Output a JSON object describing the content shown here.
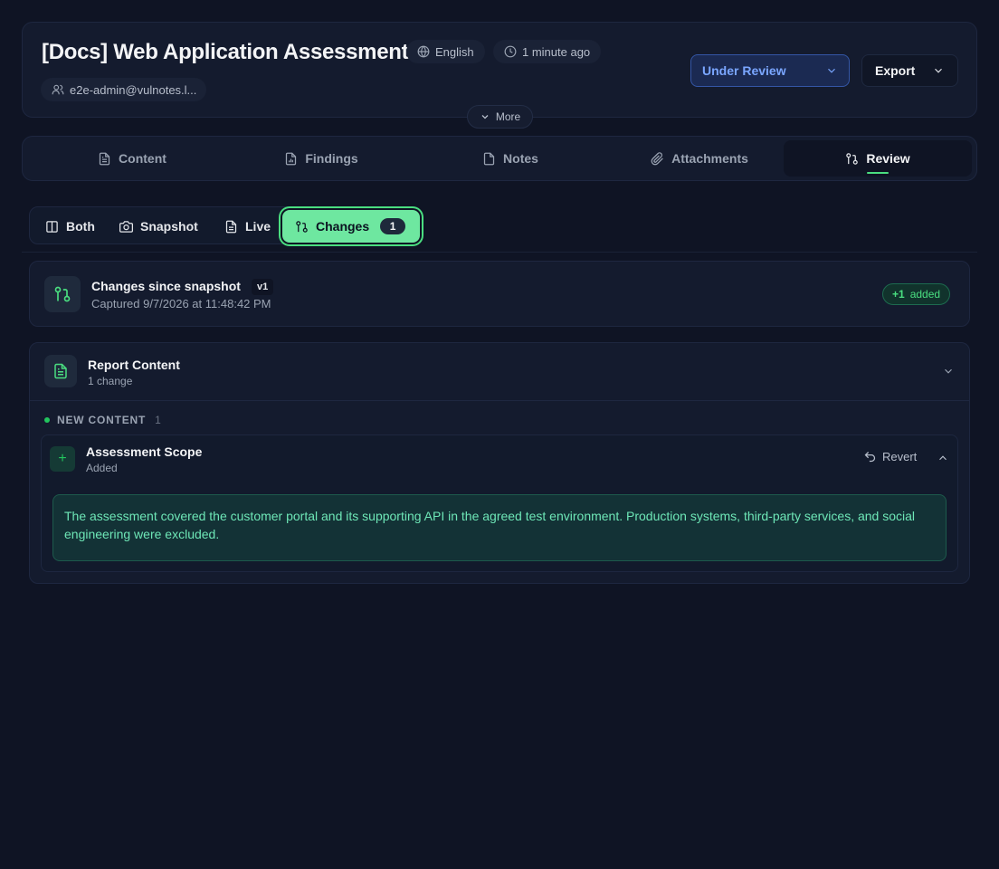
{
  "header": {
    "title": "[Docs] Web Application Assessment",
    "language": "English",
    "updated": "1 minute ago",
    "user": "e2e-admin@vulnotes.l...",
    "status": "Under Review",
    "export_label": "Export",
    "more_label": "More"
  },
  "tabs": [
    {
      "label": "Content",
      "icon": "document-icon"
    },
    {
      "label": "Findings",
      "icon": "chart-file-icon"
    },
    {
      "label": "Notes",
      "icon": "file-icon"
    },
    {
      "label": "Attachments",
      "icon": "paperclip-icon"
    },
    {
      "label": "Review",
      "icon": "git-compare-icon",
      "active": true
    }
  ],
  "view_modes": {
    "both": "Both",
    "snapshot": "Snapshot",
    "live": "Live",
    "changes": "Changes",
    "changes_count": "1"
  },
  "summary": {
    "title": "Changes since snapshot",
    "version": "v1",
    "captured": "Captured 9/7/2026 at 11:48:42 PM",
    "added_count": "+1",
    "added_label": "added"
  },
  "section": {
    "title": "Report Content",
    "subtitle": "1 change",
    "group_label": "NEW CONTENT",
    "group_count": "1",
    "item": {
      "title": "Assessment Scope",
      "status": "Added",
      "revert_label": "Revert",
      "content": "The assessment covered the customer portal and its supporting API in the agreed test environment. Production systems, third-party services, and social engineering were excluded."
    }
  },
  "colors": {
    "background": "#0f1424",
    "accent_green": "#4ade80",
    "status_blue": "#7aa6ff"
  }
}
